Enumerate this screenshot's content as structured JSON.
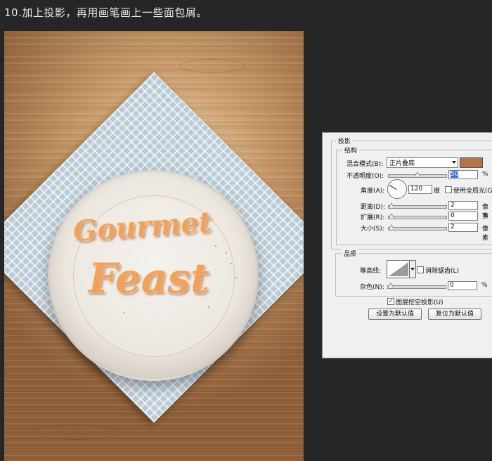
{
  "step_title": "10.加上投影，再用画笔画上一些面包屑。",
  "artwork": {
    "line1": "Gourmet",
    "line2": "Feast",
    "lettering_color": "#f0a25d"
  },
  "dialog": {
    "section_title": "投影",
    "structure": {
      "title": "结构",
      "blend_mode_label": "混合模式(B):",
      "blend_mode_value": "正片叠底",
      "shadow_color": "#b4744a",
      "opacity_label": "不透明度(O):",
      "opacity_value": "50",
      "opacity_unit": "%",
      "angle_label": "角度(A):",
      "angle_value": "120",
      "angle_unit": "度",
      "global_light_label": "使用全局光(G)",
      "global_light_checked": false,
      "distance_label": "距离(D):",
      "distance_value": "2",
      "distance_unit": "像素",
      "spread_label": "扩展(R):",
      "spread_value": "0",
      "spread_unit": "%",
      "size_label": "大小(S):",
      "size_value": "2",
      "size_unit": "像素"
    },
    "quality": {
      "title": "品质",
      "contour_label": "等高线:",
      "antialias_label": "消除锯齿(L)",
      "antialias_checked": false,
      "noise_label": "杂色(N):",
      "noise_value": "0",
      "noise_unit": "%"
    },
    "layer_knockout_label": "图层挖空投影(U)",
    "layer_knockout_checked": true,
    "make_default_label": "设置为默认值",
    "reset_default_label": "复位为默认值"
  }
}
